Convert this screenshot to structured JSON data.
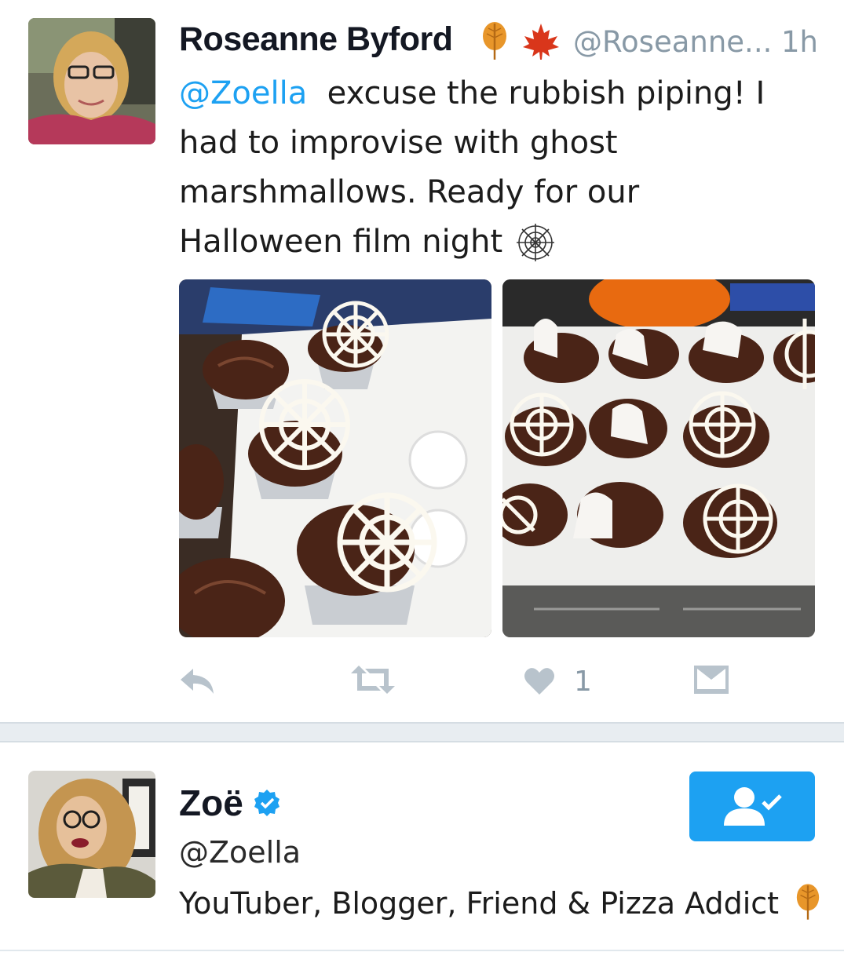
{
  "tweet": {
    "author_name": "Roseanne Byford",
    "author_handle": "@Roseanne...",
    "time": "1h",
    "name_icons": [
      "autumn-leaf-icon",
      "maple-leaf-icon"
    ],
    "mention": "@Zoella",
    "text_line1": "excuse the rubbish piping! I",
    "text_line2": "had to improvise with ghost",
    "text_line3": "marshmallows. Ready for our",
    "text_line4": "Halloween film night",
    "text_emoji": "spiderweb-icon",
    "photos": [
      "cupcakes-spiderweb-photo",
      "cupcakes-ghost-photo"
    ],
    "actions": {
      "reply": "reply-icon",
      "retweet": "retweet-icon",
      "like": "heart-icon",
      "like_count": "1",
      "dm": "envelope-icon"
    }
  },
  "profile_card": {
    "name": "Zoë",
    "verified": true,
    "handle": "@Zoella",
    "bio": "YouTuber, Blogger, Friend & Pizza Addict",
    "bio_icon": "autumn-leaf-icon",
    "follow_state": "following"
  },
  "colors": {
    "accent": "#1da1f2",
    "icon_gray": "#b8c3cc",
    "text": "#141823",
    "muted": "#8899a6",
    "leaf_orange": "#e8962a",
    "maple_red": "#d9361b"
  }
}
